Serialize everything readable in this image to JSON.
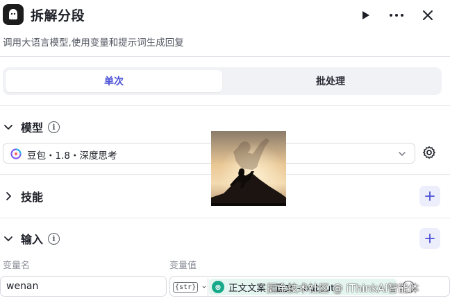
{
  "header": {
    "title": "拆解分段",
    "logo_icon": "ghost-icon",
    "run_icon": "play-icon",
    "more_icon": "more-horizontal-icon",
    "close_icon": "close-icon"
  },
  "description": "调用大语言模型,使用变量和提示词生成回复",
  "tabs": [
    {
      "label": "单次",
      "active": true
    },
    {
      "label": "批处理",
      "active": false
    }
  ],
  "sections": {
    "model": {
      "title": "模型",
      "expanded": true
    },
    "skills": {
      "title": "技能",
      "expanded": false
    },
    "input": {
      "title": "输入",
      "expanded": true
    }
  },
  "model_select": {
    "value": "豆包・1.8・深度思考"
  },
  "input_table": {
    "col_name": "变量名",
    "col_value": "变量值",
    "rows": [
      {
        "name": "wenan",
        "type": "{str}",
        "reference": "正文文案 - 正文 - output"
      }
    ]
  },
  "watermark": "掘金技术社区 @ iThinkAI智能体",
  "colors": {
    "accent": "#4a4fd6",
    "ref_green": "#17a98a",
    "ref_bg": "#e5f5f0",
    "plus_bg": "#eceefb"
  }
}
